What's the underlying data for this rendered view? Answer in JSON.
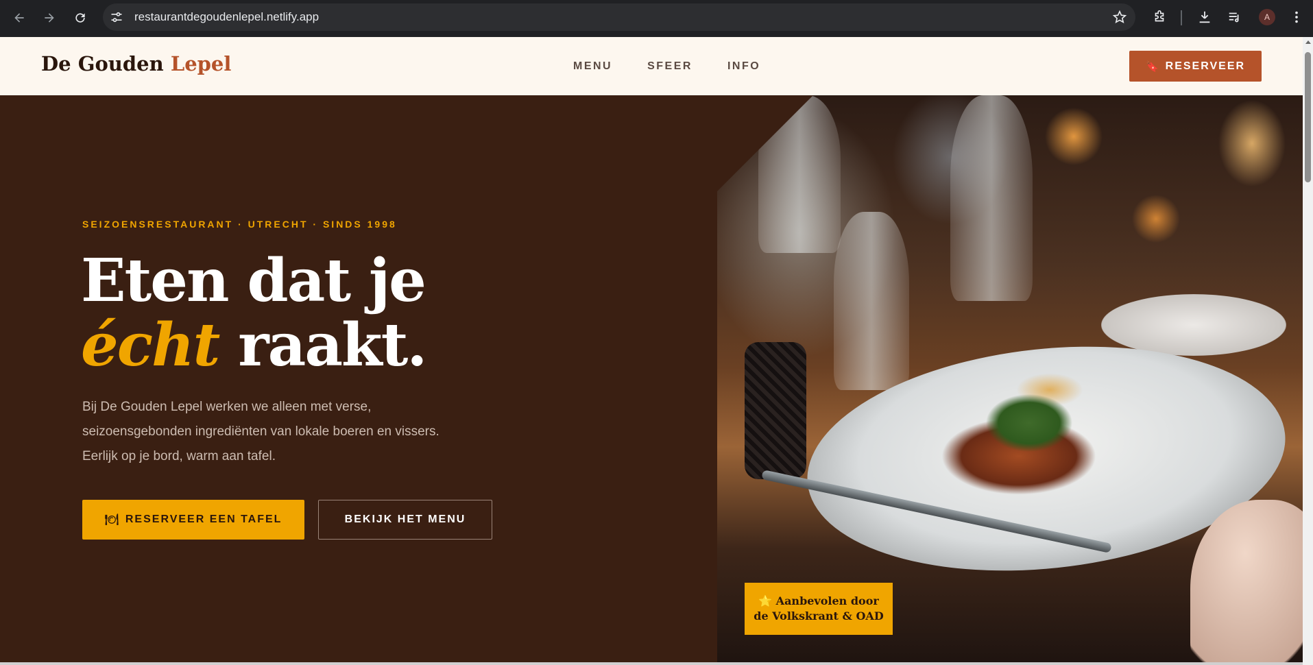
{
  "browser": {
    "url": "restaurantdegoudenlepel.netlify.app",
    "profile_initial": "A"
  },
  "header": {
    "logo_main": "De Gouden",
    "logo_accent": "Lepel",
    "nav": [
      "MENU",
      "SFEER",
      "INFO"
    ],
    "cta_label": "RESERVEER",
    "cta_icon": "🔖"
  },
  "hero": {
    "eyebrow": "SEIZOENSRESTAURANT · UTRECHT · SINDS 1998",
    "headline_line1": "Eten dat je",
    "headline_em": "écht",
    "headline_rest": "raakt.",
    "lede": "Bij De Gouden Lepel werken we alleen met verse, seizoensgebonden ingrediënten van lokale boeren en vissers. Eerlijk op je bord, warm aan tafel.",
    "primary_icon": "🍽",
    "primary_label": "RESERVEER EEN TAFEL",
    "secondary_label": "BEKIJK HET MENU",
    "badge_line1": "⭐ Aanbevolen door",
    "badge_line2": "de Volkskrant & OAD"
  },
  "colors": {
    "hero_bg": "#3a1f12",
    "accent_gold": "#f0a500",
    "accent_rust": "#b5532a",
    "header_bg": "#fdf7ef"
  }
}
